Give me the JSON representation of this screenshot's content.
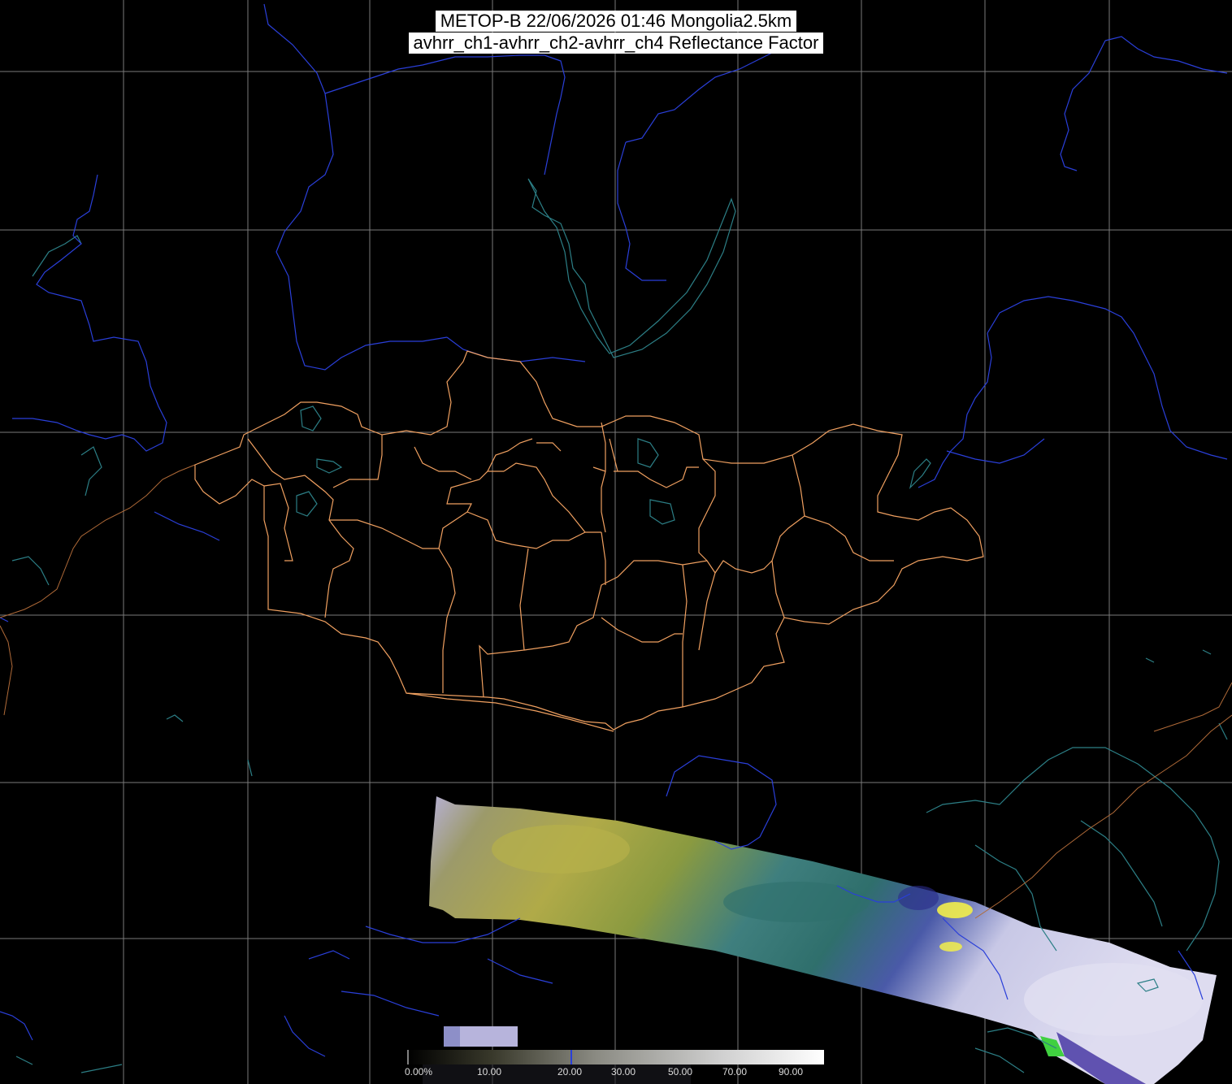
{
  "title": {
    "line1": "METOP-B 22/06/2026 01:46 Mongolia2.5km",
    "line2": "avhrr_ch1-avhrr_ch2-avhrr_ch4 Reflectance Factor"
  },
  "colorbar": {
    "labels": [
      "0.00%",
      "10.00",
      "20.00",
      "30.00",
      "50.00",
      "70.00",
      "90.00"
    ],
    "gradient_from": "#000000",
    "gradient_to": "#ffffff"
  },
  "colors": {
    "background": "#000000",
    "graticule": "#7a7a7a",
    "coastline": "#2c7f86",
    "rivers": "#2a3fd9",
    "country_border": "#c7824c",
    "province_border": "#f0a060",
    "imagery_desert": "#a8a24a",
    "imagery_vegetation": "#3f7f7e",
    "imagery_cloud": "#d8d8f0"
  }
}
